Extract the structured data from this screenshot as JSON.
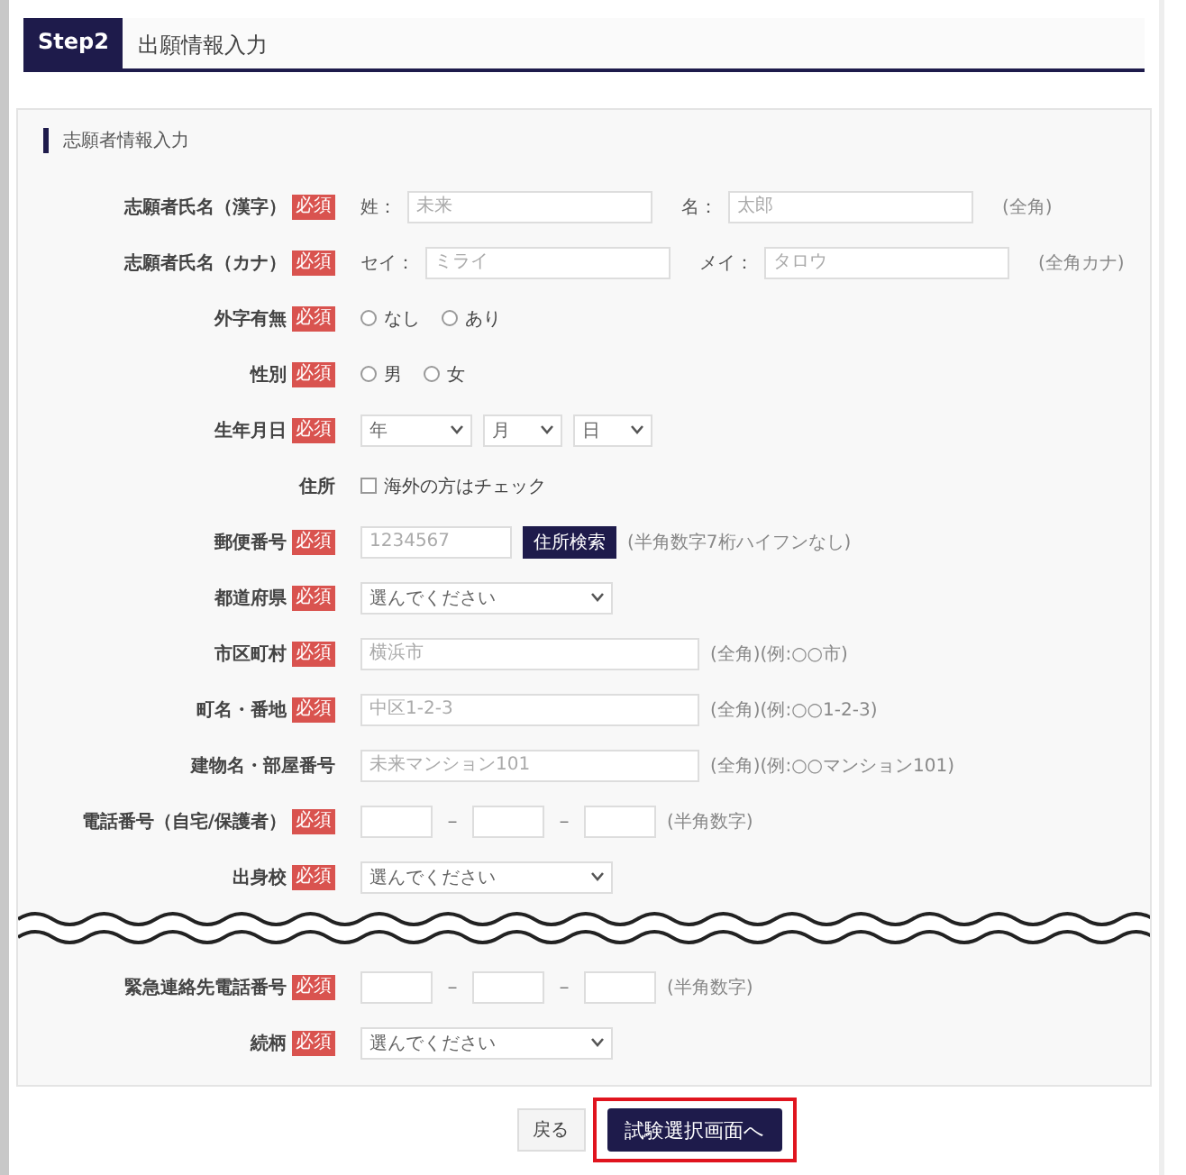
{
  "header": {
    "step": "Step2",
    "title": "出願情報入力"
  },
  "section": {
    "title": "志願者情報入力"
  },
  "fields_before_break": [
    {
      "kind": "name",
      "label": "志願者氏名（漢字）",
      "badge": "必須",
      "parts": [
        {
          "prefix": "姓：",
          "placeholder": "未来"
        },
        {
          "prefix": "名：",
          "placeholder": "太郎"
        }
      ],
      "note": "(全角)"
    },
    {
      "kind": "name",
      "label": "志願者氏名（カナ）",
      "badge": "必須",
      "parts": [
        {
          "prefix": "セイ：",
          "placeholder": "ミライ"
        },
        {
          "prefix": "メイ：",
          "placeholder": "タロウ"
        }
      ],
      "note": "(全角カナ)"
    },
    {
      "kind": "radio",
      "label": "外字有無",
      "badge": "必須",
      "options": [
        {
          "label": "なし",
          "selected": false
        },
        {
          "label": "あり",
          "selected": false
        }
      ]
    },
    {
      "kind": "radio",
      "label": "性別",
      "badge": "必須",
      "options": [
        {
          "label": "男",
          "selected": false
        },
        {
          "label": "女",
          "selected": false
        }
      ]
    },
    {
      "kind": "date",
      "label": "生年月日",
      "badge": "必須",
      "selects": [
        "年",
        "月",
        "日"
      ]
    },
    {
      "kind": "checkbox",
      "label": "住所",
      "text": "海外の方はチェック",
      "checked": false
    },
    {
      "kind": "postal",
      "label": "郵便番号",
      "badge": "必須",
      "placeholder": "1234567",
      "button": "住所検索",
      "note": "(半角数字7桁ハイフンなし)"
    },
    {
      "kind": "select",
      "label": "都道府県",
      "badge": "必須",
      "value": "選んでください"
    },
    {
      "kind": "text",
      "label": "市区町村",
      "badge": "必須",
      "placeholder": "横浜市",
      "note": "(全角)(例:○○市)"
    },
    {
      "kind": "text",
      "label": "町名・番地",
      "badge": "必須",
      "placeholder": "中区1-2-3",
      "note": "(全角)(例:○○1-2-3)"
    },
    {
      "kind": "text",
      "label": "建物名・部屋番号",
      "placeholder": "未来マンション101",
      "note": "(全角)(例:○○マンション101)"
    },
    {
      "kind": "phone",
      "label": "電話番号（自宅/保護者）",
      "badge": "必須",
      "separator": "－",
      "note": "(半角数字)"
    },
    {
      "kind": "select",
      "label": "出身校",
      "badge": "必須",
      "value": "選んでください"
    }
  ],
  "fields_after_break": [
    {
      "kind": "phone",
      "label": "緊急連絡先電話番号",
      "badge": "必須",
      "separator": "－",
      "note": "(半角数字)"
    },
    {
      "kind": "select",
      "label": "続柄",
      "badge": "必須",
      "value": "選んでください"
    }
  ],
  "buttons": {
    "back": "戻る",
    "next": "試験選択画面へ"
  }
}
